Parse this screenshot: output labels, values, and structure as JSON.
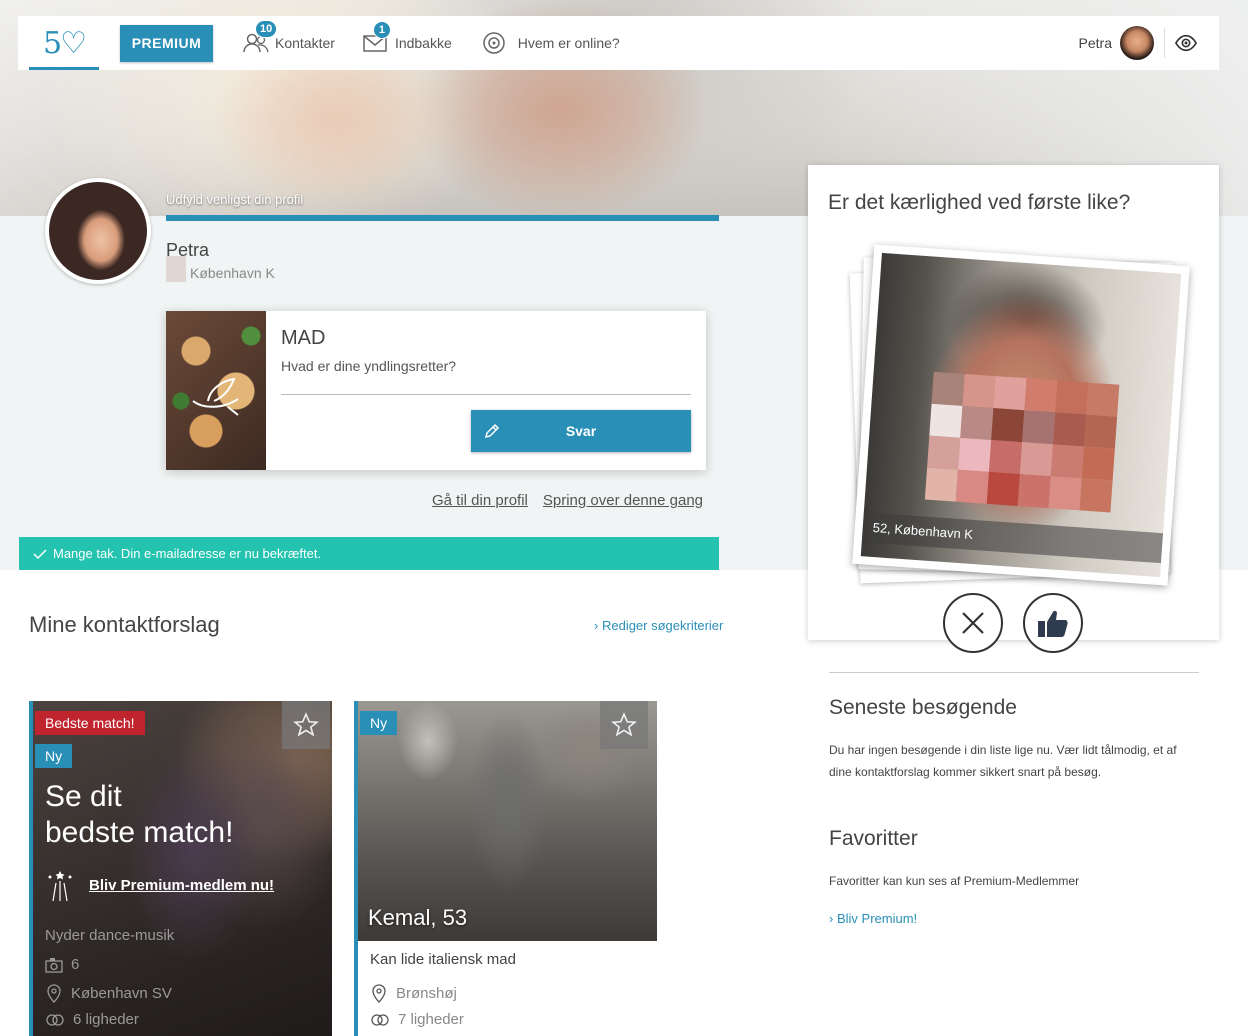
{
  "nav": {
    "premium_label": "PREMIUM",
    "contacts_label": "Kontakter",
    "contacts_badge": "10",
    "inbox_label": "Indbakke",
    "inbox_badge": "1",
    "online_label": "Hvem er online?",
    "user_name": "Petra"
  },
  "profile": {
    "progress_label": "Udfyld venligst din profil",
    "name": "Petra",
    "location": "København K"
  },
  "question": {
    "category": "MAD",
    "text": "Hvad er dine yndlingsretter?",
    "answer_button": "Svar",
    "go_to_profile": "Gå til din profil",
    "skip": "Spring over denne gang"
  },
  "confirmation": "Mange tak. Din e-mailadresse er nu bekræftet.",
  "contacts": {
    "title": "Mine kontaktforslag",
    "edit_link": "Rediger søgekriterier",
    "cards": [
      {
        "badge_best": "Bedste match!",
        "badge_new": "Ny",
        "headline_line1": "Se dit",
        "headline_line2": "bedste match!",
        "premium_cta": "Bliv Premium-medlem nu!",
        "interest": "Nyder dance-musik",
        "photos": "6",
        "location": "København SV",
        "similarities": "6 ligheder"
      },
      {
        "badge_new": "Ny",
        "name": "Kemal, 53",
        "interest": "Kan lide italiensk mad",
        "location": "Brønshøj",
        "similarities": "7 ligheder"
      }
    ]
  },
  "love_at_first_like": {
    "title": "Er det kærlighed ved første like?",
    "caption": "52, København K"
  },
  "recent_visitors": {
    "title": "Seneste besøgende",
    "text": "Du har ingen besøgende i din liste lige nu. Vær lidt tålmodig, et af dine kontaktforslag kommer sikkert snart på besøg."
  },
  "favorites": {
    "title": "Favoritter",
    "text": "Favoritter kan kun ses af Premium-Medlemmer",
    "link": "Bliv Premium!"
  },
  "colors": {
    "accent": "#2a8fb7",
    "success": "#23c3b0",
    "best_badge": "#c0242f"
  }
}
